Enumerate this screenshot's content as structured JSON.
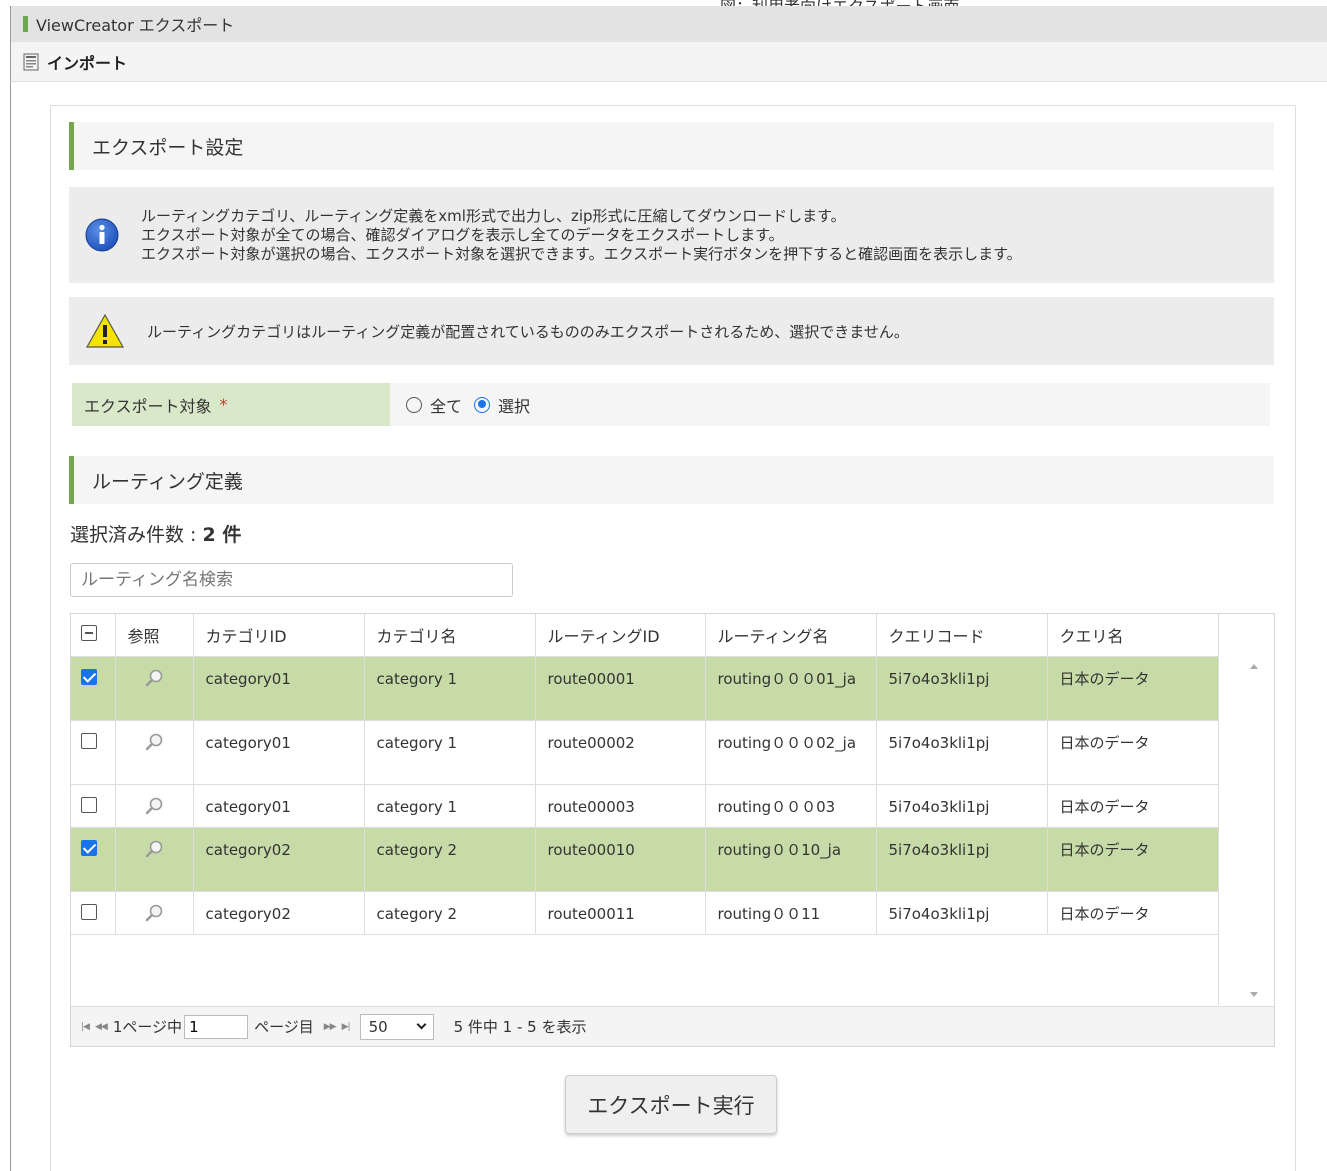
{
  "window": {
    "title": "ViewCreator エクスポート",
    "cutoff_caption": "図：利用者向けエクスポート画面"
  },
  "toolbar": {
    "import_label": "インポート",
    "icon": "import-icon"
  },
  "export_settings": {
    "header": "エクスポート設定",
    "info_lines": [
      "ルーティングカテゴリ、ルーティング定義をxml形式で出力し、zip形式に圧縮してダウンロードします。",
      "エクスポート対象が全ての場合、確認ダイアログを表示し全てのデータをエクスポートします。",
      "エクスポート対象が選択の場合、エクスポート対象を選択できます。エクスポート実行ボタンを押下すると確認画面を表示します。"
    ],
    "warning": "ルーティングカテゴリはルーティング定義が配置されているもののみエクスポートされるため、選択できません。",
    "target_label": "エクスポート対象",
    "required_mark": "*",
    "options": [
      {
        "label": "全て",
        "checked": false
      },
      {
        "label": "選択",
        "checked": true
      }
    ]
  },
  "routing": {
    "header": "ルーティング定義",
    "count_label": "選択済み件数 : ",
    "count_value": "2 件",
    "search_placeholder": "ルーティング名検索",
    "columns": [
      "参照",
      "カテゴリID",
      "カテゴリ名",
      "ルーティングID",
      "ルーティング名",
      "クエリコード",
      "クエリ名"
    ],
    "rows": [
      {
        "checked": true,
        "category_id": "category01",
        "category_name": "category 1",
        "routing_id": "route00001",
        "routing_name": "routing０００01_ja",
        "query_code": "5i7o4o3kli1pj",
        "query_name": "日本のデータ"
      },
      {
        "checked": false,
        "category_id": "category01",
        "category_name": "category 1",
        "routing_id": "route00002",
        "routing_name": "routing０００02_ja",
        "query_code": "5i7o4o3kli1pj",
        "query_name": "日本のデータ"
      },
      {
        "checked": false,
        "category_id": "category01",
        "category_name": "category 1",
        "routing_id": "route00003",
        "routing_name": "routing０００03",
        "query_code": "5i7o4o3kli1pj",
        "query_name": "日本のデータ"
      },
      {
        "checked": true,
        "category_id": "category02",
        "category_name": "category 2",
        "routing_id": "route00010",
        "routing_name": "routing００10_ja",
        "query_code": "5i7o4o3kli1pj",
        "query_name": "日本のデータ"
      },
      {
        "checked": false,
        "category_id": "category02",
        "category_name": "category 2",
        "routing_id": "route00011",
        "routing_name": "routing００11",
        "query_code": "5i7o4o3kli1pj",
        "query_name": "日本のデータ"
      }
    ],
    "pager": {
      "page_of": "1ページ中",
      "page_value": "1",
      "page_suffix": "ページ目",
      "page_size": "50",
      "summary": "5 件中 1 - 5 を表示"
    }
  },
  "exec_button": "エクスポート実行",
  "colors": {
    "accent_green": "#76a550",
    "selected_row": "#c6dba8",
    "label_bg": "#d8e8c8",
    "checkbox_blue": "#1a73e8"
  }
}
